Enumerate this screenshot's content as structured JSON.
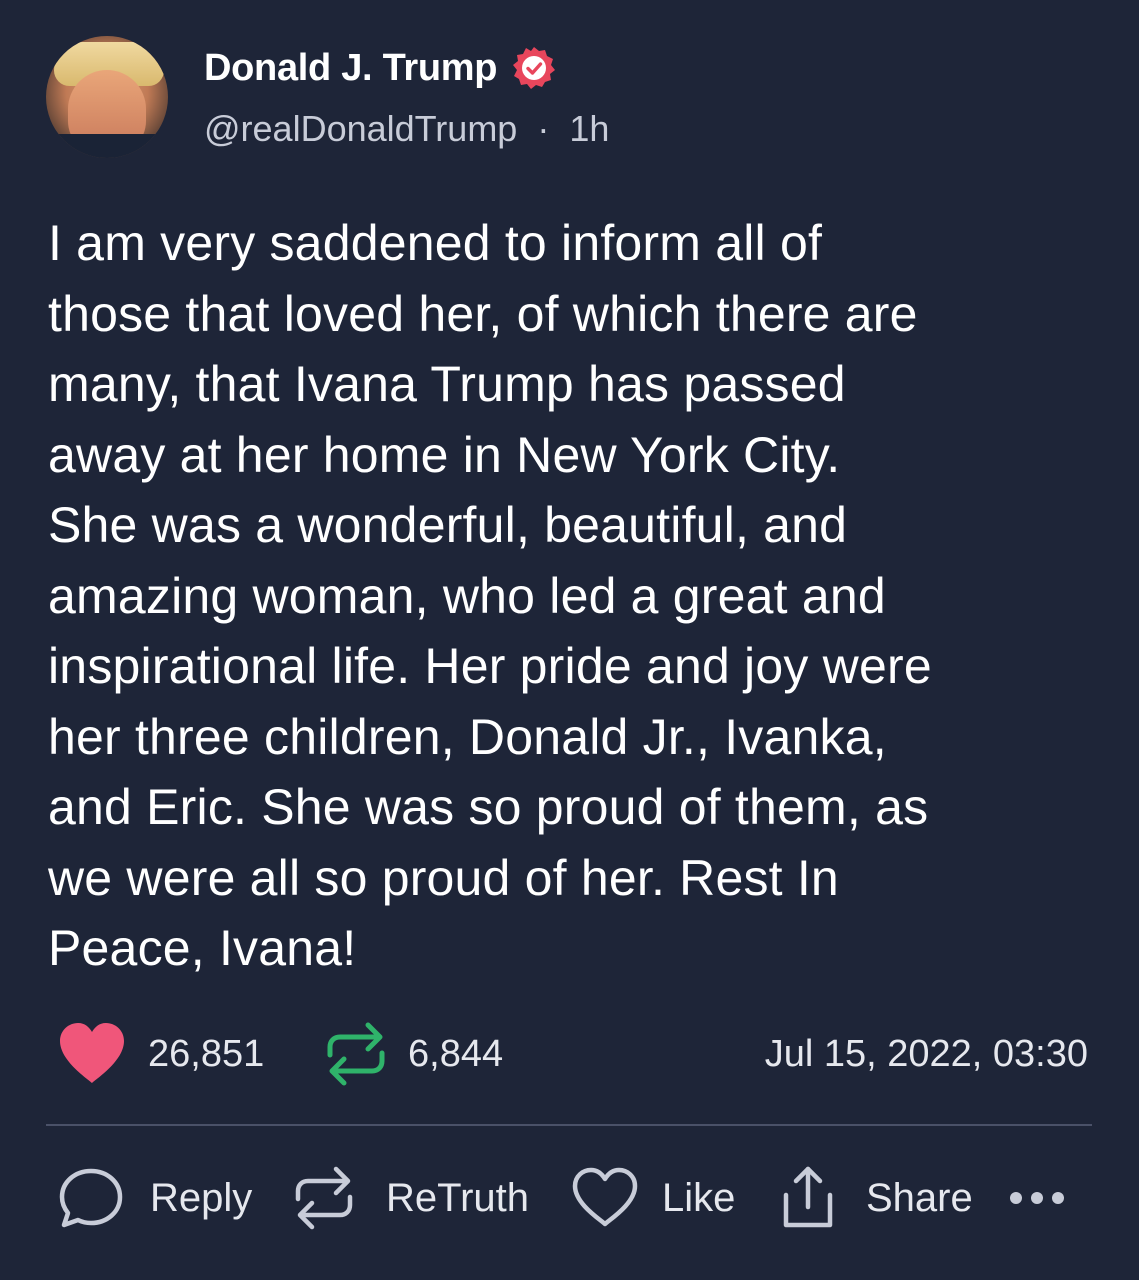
{
  "author": {
    "display_name": "Donald J. Trump",
    "handle": "@realDonaldTrump",
    "separator": "·",
    "time_ago": "1h"
  },
  "post": {
    "lines": [
      "I am very saddened to inform all of",
      "those that loved her, of which there are",
      "many, that Ivana Trump has passed",
      "away at her home in New York City.",
      "She was a wonderful, beautiful, and",
      "amazing woman, who led a great and",
      "inspirational life. Her pride and joy were",
      "her three children, Donald Jr., Ivanka,",
      "and Eric. She was so proud of them, as",
      "we were all so proud of her. Rest In",
      "Peace, Ivana!"
    ]
  },
  "stats": {
    "likes": "26,851",
    "retruths": "6,844",
    "timestamp": "Jul 15, 2022, 03:30"
  },
  "actions": {
    "reply": "Reply",
    "retruth": "ReTruth",
    "like": "Like",
    "share": "Share"
  },
  "colors": {
    "background": "#1e2538",
    "heart": "#f0567a",
    "retruth_green": "#2fb36a",
    "verified_badge": "#e8465c",
    "icon_gray": "#c8ccd8"
  }
}
